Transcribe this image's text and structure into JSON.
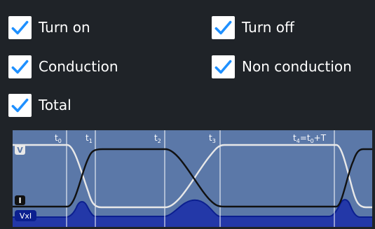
{
  "options": [
    {
      "id": "turn_on",
      "label": "Turn on",
      "checked": true
    },
    {
      "id": "turn_off",
      "label": "Turn off",
      "checked": true
    },
    {
      "id": "conduction",
      "label": "Conduction",
      "checked": true
    },
    {
      "id": "non_conduction",
      "label": "Non conduction",
      "checked": true
    },
    {
      "id": "total",
      "label": "Total",
      "checked": true
    }
  ],
  "diagram": {
    "markers": {
      "t0": {
        "main": "t",
        "sub": "0",
        "tail": ""
      },
      "t1": {
        "main": "t",
        "sub": "1",
        "tail": ""
      },
      "t2": {
        "main": "t",
        "sub": "2",
        "tail": ""
      },
      "t3": {
        "main": "t",
        "sub": "3",
        "tail": ""
      },
      "t4": {
        "main": "t",
        "sub": "4",
        "tail": "=t",
        "sub2": "0",
        "tail2": "+T"
      }
    },
    "signals": {
      "v": "V",
      "i": "I",
      "vxi": "VxI"
    }
  },
  "colors": {
    "background": "#1f2328",
    "checkbox": "#ffffff",
    "check_mark": "#1e90ff",
    "diagram_bg": "#5b78a8",
    "v_trace": "#e8e8e8",
    "i_trace": "#111111",
    "vxi_trace": "#0b1f8f",
    "vxi_fill": "#2338a8"
  }
}
